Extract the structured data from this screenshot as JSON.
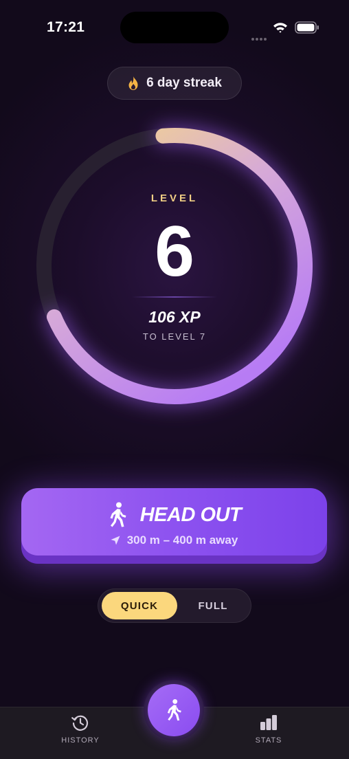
{
  "status_bar": {
    "time": "17:21",
    "icons": [
      "signal-dots",
      "wifi-icon",
      "battery-icon"
    ]
  },
  "streak": {
    "icon": "flame-icon",
    "label": "6 day streak"
  },
  "level": {
    "label": "LEVEL",
    "number": "6",
    "xp": "106 XP",
    "caption": "TO LEVEL 7",
    "progress_fraction": 0.7
  },
  "head_out": {
    "icon": "walker-icon",
    "label": "HEAD OUT",
    "distance_icon": "location-arrow-icon",
    "distance": "300 m – 400 m away"
  },
  "mode_toggle": {
    "options": [
      {
        "label": "QUICK",
        "selected": true
      },
      {
        "label": "FULL",
        "selected": false
      }
    ]
  },
  "tab_bar": {
    "history": {
      "icon": "history-icon",
      "label": "HISTORY"
    },
    "center": {
      "icon": "walker-icon"
    },
    "stats": {
      "icon": "stats-icon",
      "label": "STATS"
    }
  },
  "colors": {
    "background": "#12081b",
    "accent_purple": "#8d52f0",
    "accent_gold": "#fbd77d",
    "ring_start": "#b77cf4",
    "ring_end": "#f3d48f"
  }
}
